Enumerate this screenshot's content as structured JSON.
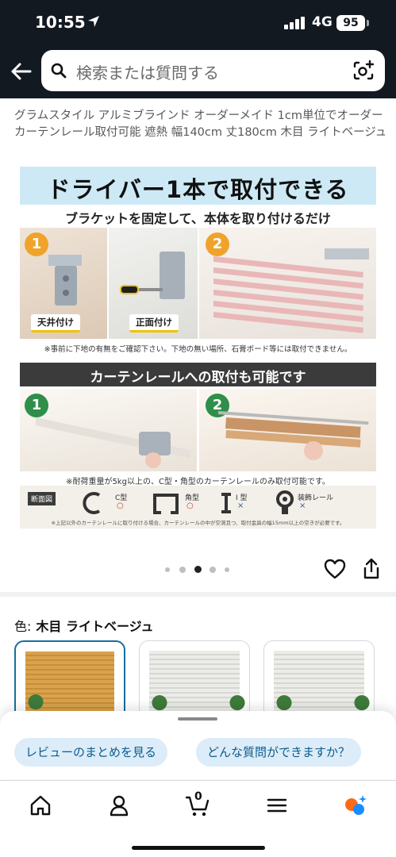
{
  "status_bar": {
    "time": "10:55",
    "network": "4G",
    "battery": "95"
  },
  "header": {
    "search_placeholder": "検索または質問する"
  },
  "product": {
    "title": "グラムスタイル アルミブラインド オーダーメイド 1cm単位でオーダー カーテンレール取付可能 遮熱 幅140cm 丈180cm 木目 ライトベージュ"
  },
  "product_image": {
    "headline": "ドライバー1本で取付できる",
    "subheadline": "ブラケットを固定して、本体を取り付けるだけ",
    "step_numbers": [
      "1",
      "2"
    ],
    "label_ceiling": "天井付け",
    "label_front": "正面付け",
    "note_wall": "※事前に下地の有無をご確認下さい。下地の無い場所、石膏ボード等には取付できません。",
    "curtain_rail_banner": "カーテンレールへの取付も可能です",
    "note_weight": "※耐荷重量が5kg以上の、C型・角型のカーテンレールのみ取付可能です。",
    "cross_section_label": "断面図",
    "rail_types": [
      {
        "name": "C型",
        "mark": "○"
      },
      {
        "name": "角型",
        "mark": "○"
      },
      {
        "name": "I 型",
        "mark": "×"
      },
      {
        "name": "装飾レール",
        "mark": "×"
      }
    ],
    "fine_print": "※上記以外のカーテンレールに取り付ける場合、カーテンレールの中が空洞且つ、取付金具の幅15mm以上の空きが必要です。"
  },
  "carousel": {
    "total": 5,
    "active_index": 2
  },
  "variation": {
    "label": "色:",
    "selected": "木目 ライトベージュ"
  },
  "assistant_chips": [
    "レビューのまとめを見る",
    "どんな質問ができますか？"
  ],
  "tabbar": {
    "cart_count": "0"
  },
  "colors": {
    "header_bg": "#131921",
    "chip_bg": "#dcecf8",
    "chip_text": "#0b5c8c",
    "selected_border": "#1b6c9e"
  }
}
